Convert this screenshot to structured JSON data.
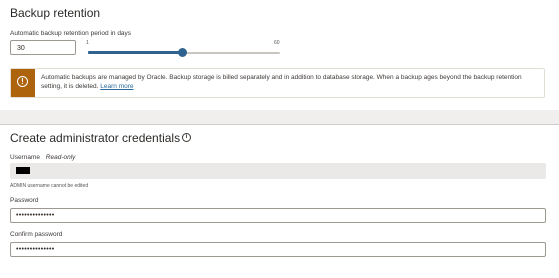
{
  "retention": {
    "title": "Backup retention",
    "field_label": "Automatic backup retention period in days",
    "days_value": "30",
    "slider_min": "1",
    "slider_max": "60",
    "slider_value": 30,
    "warning_text": "Automatic backups are managed by Oracle. Backup storage is billed separately and in addition to database storage. When a backup ages beyond the backup retention setting, it is deleted.",
    "warning_link": "Learn more",
    "warning_color": "#ac630c",
    "accent_color": "#2f628f"
  },
  "admin": {
    "title": "Create administrator credentials",
    "title_icon": "info-icon",
    "username_label": "Username",
    "username_note": "Read-only",
    "username_hint": "ADMIN username cannot be edited",
    "password_label": "Password",
    "password_value": "••••••••••••••",
    "confirm_label": "Confirm password",
    "confirm_value": "••••••••••••••"
  }
}
